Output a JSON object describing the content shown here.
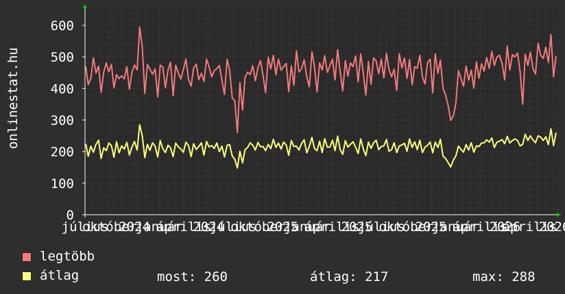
{
  "chart_data": {
    "type": "line",
    "ylabel": "onlinestat.hu",
    "ylim": [
      0,
      650
    ],
    "yticks": [
      0,
      100,
      200,
      300,
      400,
      500,
      600
    ],
    "grid": true,
    "xticks": [
      "július",
      "október",
      "2024",
      "január",
      "április",
      "2024",
      "július",
      "október",
      "2025",
      "január",
      "április",
      "2025",
      "július",
      "október",
      "2025",
      "január",
      "április",
      "2026",
      "április",
      "2026"
    ],
    "series": [
      {
        "name": "legtöbb",
        "color": "#f47a7a",
        "values": [
          470,
          412,
          432,
          497,
          449,
          471,
          388,
          451,
          481,
          453,
          476,
          402,
          444,
          431,
          440,
          430,
          469,
          398,
          452,
          474,
          459,
          594,
          533,
          384,
          476,
          461,
          445,
          462,
          373,
          474,
          468,
          402,
          458,
          483,
          377,
          474,
          449,
          430,
          460,
          493,
          429,
          407,
          465,
          477,
          428,
          448,
          422,
          493,
          469,
          437,
          456,
          463,
          473,
          426,
          381,
          492,
          458,
          370,
          361,
          260,
          419,
          331,
          435,
          452,
          444,
          472,
          424,
          467,
          488,
          440,
          386,
          499,
          462,
          505,
          443,
          493,
          458,
          469,
          479,
          390,
          472,
          410,
          519,
          452,
          463,
          491,
          437,
          405,
          516,
          471,
          389,
          481,
          459,
          504,
          451,
          472,
          493,
          427,
          523,
          453,
          392,
          488,
          439,
          481,
          469,
          503,
          421,
          510,
          447,
          379,
          486,
          413,
          497,
          487,
          447,
          493,
          433,
          512,
          460,
          437,
          461,
          394,
          510,
          465,
          496,
          432,
          492,
          412,
          469,
          464,
          505,
          436,
          414,
          482,
          493,
          386,
          510,
          448,
          490,
          401,
          379,
          346,
          299,
          313,
          353,
          456,
          431,
          407,
          471,
          426,
          458,
          401,
          484,
          432,
          478,
          455,
          498,
          464,
          517,
          473,
          500,
          505,
          479,
          427,
          535,
          458,
          507,
          500,
          512,
          454,
          350,
          509,
          473,
          515,
          463,
          446,
          543,
          505,
          495,
          531,
          482,
          571,
          437,
          503
        ],
        "most": "",
        "atlag": "",
        "max": ""
      },
      {
        "name": "átlag",
        "color": "#ffff80",
        "values": [
          225,
          185,
          217,
          198,
          223,
          236,
          178,
          212,
          203,
          227,
          219,
          182,
          231,
          196,
          218,
          208,
          229,
          189,
          215,
          232,
          205,
          285,
          250,
          181,
          223,
          204,
          228,
          217,
          183,
          235,
          209,
          197,
          220,
          212,
          184,
          227,
          215,
          208,
          198,
          230,
          219,
          184,
          225,
          207,
          216,
          228,
          189,
          232,
          215,
          219,
          210,
          227,
          200,
          217,
          183,
          220,
          222,
          186,
          176,
          148,
          201,
          164,
          206,
          213,
          228,
          220,
          205,
          229,
          215,
          216,
          203,
          223,
          209,
          239,
          213,
          227,
          208,
          230,
          221,
          188,
          235,
          216,
          217,
          205,
          226,
          237,
          196,
          216,
          245,
          210,
          203,
          233,
          197,
          241,
          214,
          214,
          236,
          203,
          249,
          206,
          191,
          235,
          214,
          223,
          231,
          214,
          194,
          240,
          208,
          187,
          230,
          210,
          228,
          236,
          206,
          216,
          218,
          238,
          201,
          206,
          228,
          197,
          218,
          221,
          226,
          201,
          240,
          213,
          231,
          206,
          236,
          197,
          214,
          220,
          230,
          196,
          230,
          213,
          239,
          186,
          178,
          165,
          151,
          173,
          186,
          217,
          207,
          198,
          222,
          205,
          228,
          198,
          218,
          216,
          227,
          228,
          237,
          230,
          243,
          213,
          230,
          233,
          238,
          225,
          248,
          227,
          235,
          240,
          235,
          218,
          223,
          255,
          235,
          250,
          237,
          228,
          250,
          246,
          235,
          247,
          222,
          272,
          219,
          260
        ],
        "most": "260",
        "atlag": "217",
        "max": "288"
      }
    ]
  },
  "legend": {
    "item1_label": "legtöbb",
    "item2_label": "átlag",
    "most_label": "most: 260",
    "atlag_label": "átlag: 217",
    "max_label": "max: 288"
  },
  "colors": {
    "background": "#2e2e2e",
    "plot_background": "#2a2a2a",
    "grid_major": "#5a3c3c",
    "grid_minor": "#3c3c3c",
    "axis": "#ffffff",
    "axis_arrow": "#00cc00"
  }
}
